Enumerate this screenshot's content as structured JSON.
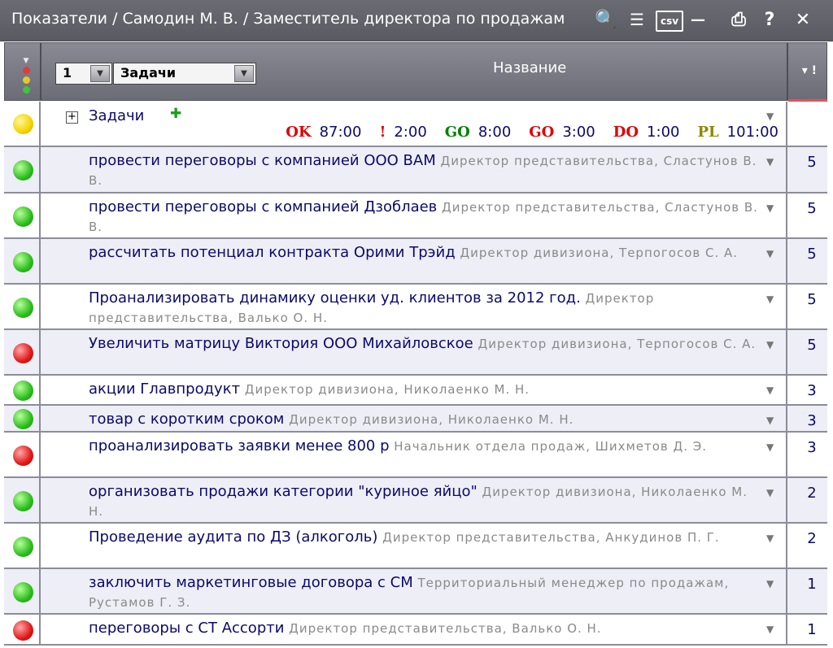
{
  "window": {
    "title": "Показатели / Самодин М. В. / Заместитель директора по продажам",
    "icons": {
      "search": "🔍",
      "list": "☰",
      "csv": "csv",
      "minimize": "—",
      "print": "⎙",
      "help": "?",
      "close": "✕"
    }
  },
  "header": {
    "page_number": "1",
    "selector_value": "Задачи",
    "column_title": "Название",
    "sort_label": "▾ !",
    "dropdown_glyph": "▼",
    "traffic_arrow": "▼"
  },
  "glyphs": {
    "expand": "+",
    "add": "✚",
    "row_menu": "▼"
  },
  "colors": {
    "ok": "#e00000",
    "excl": "#e00000",
    "go_green": "#008000",
    "go_red": "#e00000",
    "do": "#e00000",
    "pl": "#8a8a00"
  },
  "group": {
    "status": "yellow",
    "title": "Задачи",
    "stats": [
      {
        "code": "OK",
        "value": "87:00"
      },
      {
        "code": "!",
        "value": "2:00"
      },
      {
        "code": "GO",
        "value": "8:00"
      },
      {
        "code": "GO",
        "value": "3:00"
      },
      {
        "code": "DO",
        "value": "1:00"
      },
      {
        "code": "PL",
        "value": "101:00"
      }
    ]
  },
  "tasks": [
    {
      "status": "green",
      "title": "провести переговоры с компанией ООО ВАМ",
      "owner": "Директор представительства, Сластунов В. В.",
      "value": "5"
    },
    {
      "status": "green",
      "title": "провести переговоры с компанией Дзоблаев",
      "owner": "Директор представительства, Сластунов В. В.",
      "value": "5"
    },
    {
      "status": "green",
      "title": "рассчитать потенциал контракта Орими Трэйд",
      "owner": "Директор дивизиона, Терпогосов С. А.",
      "value": "5"
    },
    {
      "status": "green",
      "title": "Проанализировать динамику оценки уд. клиентов за 2012 год.",
      "owner": "Директор представительства, Валько О. Н.",
      "value": "5"
    },
    {
      "status": "red",
      "title": "Увеличить матрицу Виктория ООО Михайловское",
      "owner": "Директор дивизиона, Терпогосов С. А.",
      "value": "5"
    },
    {
      "status": "green",
      "title": "акции Главпродукт",
      "owner": "Директор дивизиона, Николаенко М. Н.",
      "value": "3"
    },
    {
      "status": "green",
      "title": "товар с коротким сроком",
      "owner": "Директор дивизиона, Николаенко М. Н.",
      "value": "3"
    },
    {
      "status": "red",
      "title": "проанализировать заявки менее 800 р",
      "owner": "Начальник отдела продаж, Шихметов Д. Э.",
      "value": "3"
    },
    {
      "status": "green",
      "title": "организовать продажи категории \"куриное яйцо\"",
      "owner": "Директор дивизиона, Николаенко М. Н.",
      "value": "2"
    },
    {
      "status": "green",
      "title": "Проведение аудита по ДЗ (алкоголь)",
      "owner": "Директор представительства, Анкудинов П. Г.",
      "value": "2"
    },
    {
      "status": "green",
      "title": "заключить маркетинговые договора с СМ",
      "owner": "Территориальный менеджер по продажам, Рустамов Г. З.",
      "value": "1"
    },
    {
      "status": "red",
      "title": "переговоры с СТ Ассорти",
      "owner": "Директор представительства, Валько О. Н.",
      "value": "1"
    }
  ]
}
